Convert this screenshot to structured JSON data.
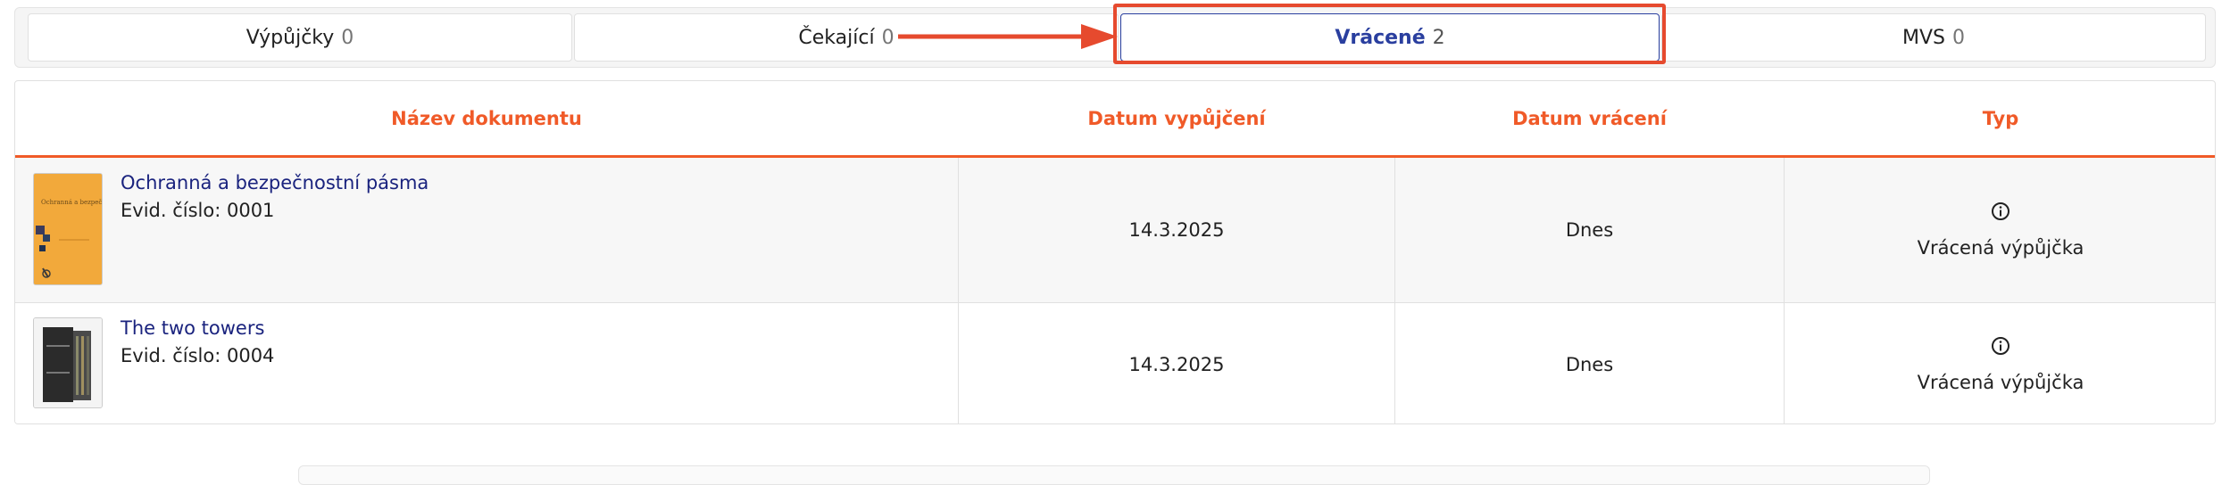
{
  "tabs": [
    {
      "label": "Výpůjčky",
      "count": "0"
    },
    {
      "label": "Čekající",
      "count": "0"
    },
    {
      "label": "Vrácené",
      "count": "2"
    },
    {
      "label": "MVS",
      "count": "0"
    }
  ],
  "active_tab": "Vrácené",
  "annotation_color": "#e64a2e",
  "table": {
    "headers": [
      "Název dokumentu",
      "Datum vypůjčení",
      "Datum vrácení",
      "Typ"
    ],
    "rows": [
      {
        "title": "Ochranná a bezpečnostní pásma",
        "evid": "Evid. číslo: 0001",
        "borrowed": "14.3.2025",
        "returned": "Dnes",
        "type": "Vrácená výpůjčka",
        "cover_text": "Ochranná a bezpečnostní pásma"
      },
      {
        "title": "The two towers",
        "evid": "Evid. číslo: 0004",
        "borrowed": "14.3.2025",
        "returned": "Dnes",
        "type": "Vrácená výpůjčka"
      }
    ]
  },
  "colors": {
    "accent_orange": "#f05a28",
    "active_blue": "#2a3f9f",
    "link_blue": "#1a237e"
  },
  "icons": {
    "type_icon": "info-circle-icon"
  }
}
